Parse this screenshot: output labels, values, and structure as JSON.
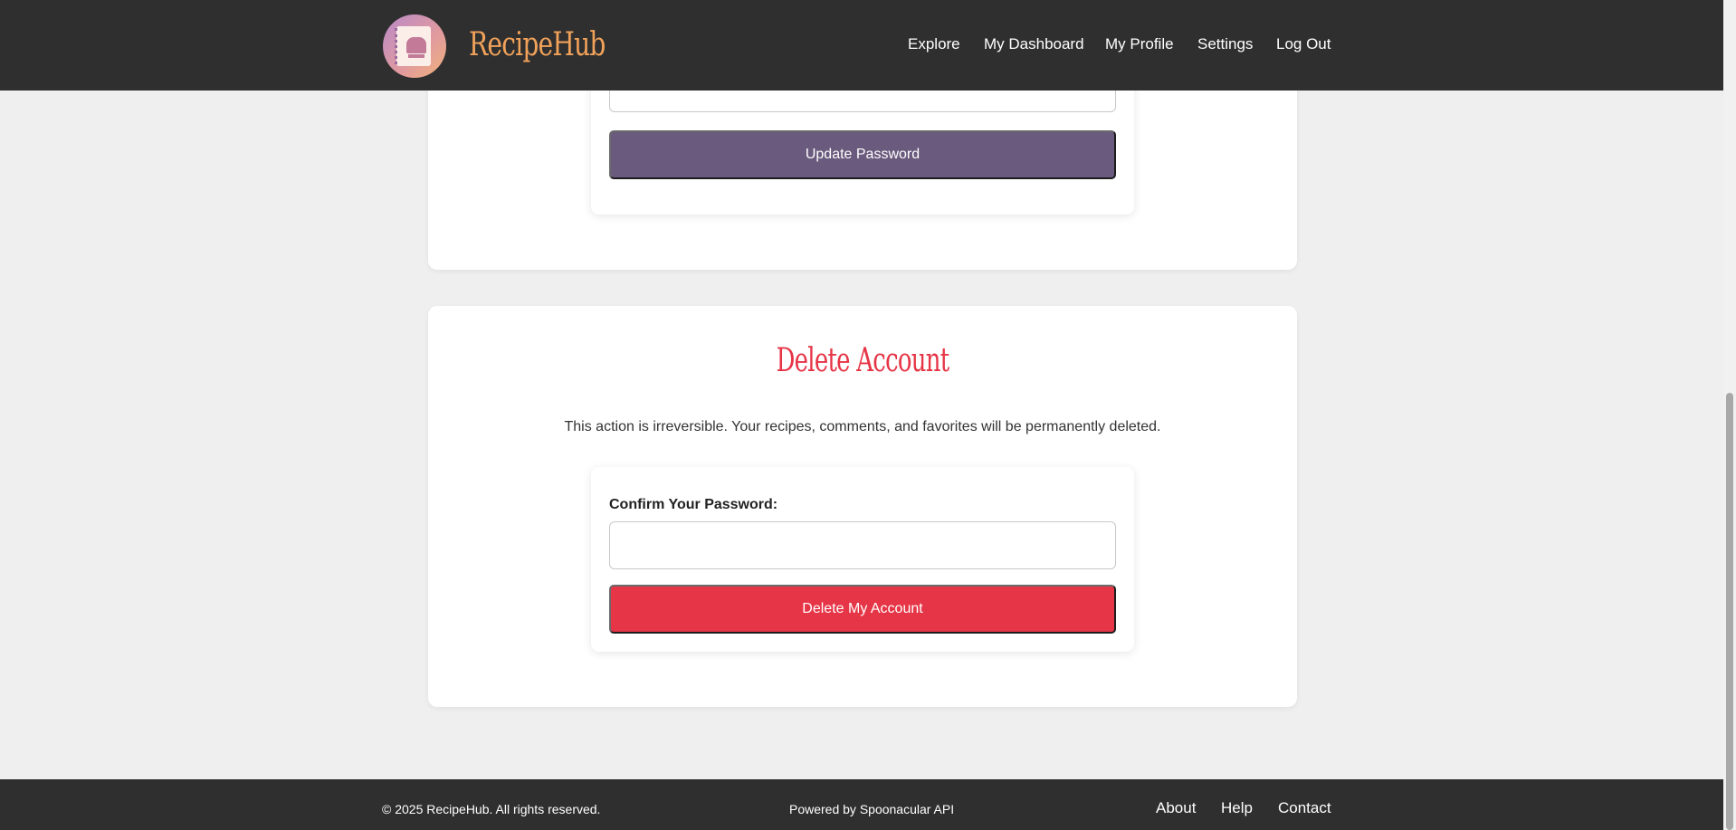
{
  "header": {
    "brand": "RecipeHub",
    "nav": [
      "Explore",
      "My Dashboard",
      "My Profile",
      "Settings",
      "Log Out"
    ]
  },
  "password_section": {
    "update_button": "Update Password"
  },
  "delete_section": {
    "title": "Delete Account",
    "warning": "This action is irreversible. Your recipes, comments, and favorites will be permanently deleted.",
    "confirm_label": "Confirm Your Password:",
    "confirm_value": "",
    "delete_button": "Delete My Account"
  },
  "footer": {
    "copyright": "© 2025 RecipeHub. All rights reserved.",
    "powered_by": "Powered by Spoonacular API",
    "links": [
      "About",
      "Help",
      "Contact"
    ]
  },
  "colors": {
    "header_bg": "#2f2f2f",
    "brand": "#f1a25a",
    "update_button": "#6a5a7d",
    "danger": "#e63546",
    "page_bg": "#efefef"
  },
  "icons": {
    "logo": "recipe-book-chef-hat-icon"
  }
}
